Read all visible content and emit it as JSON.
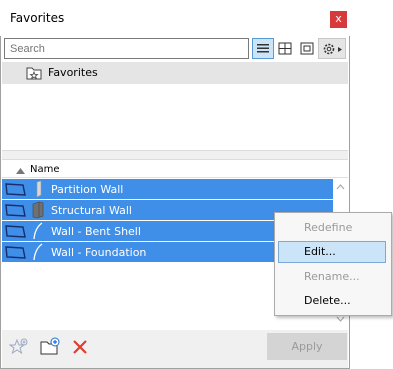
{
  "window": {
    "title": "Favorites",
    "close_label": "x"
  },
  "search": {
    "placeholder": "Search"
  },
  "folder": {
    "label": "Favorites"
  },
  "list": {
    "column_name": "Name",
    "rows": [
      {
        "label": "Partition Wall"
      },
      {
        "label": "Structural Wall"
      },
      {
        "label": "Wall - Bent Shell"
      },
      {
        "label": "Wall - Foundation"
      }
    ]
  },
  "context_menu": {
    "items": [
      {
        "label": "Redefine",
        "enabled": false
      },
      {
        "label": "Edit...",
        "enabled": true,
        "highlighted": true
      },
      {
        "label": "Rename...",
        "enabled": false
      },
      {
        "label": "Delete...",
        "enabled": true
      }
    ]
  },
  "footer": {
    "apply_label": "Apply"
  },
  "colors": {
    "selection": "#3f8ee8",
    "close": "#d73a3a",
    "delete_x": "#e03c2e"
  }
}
